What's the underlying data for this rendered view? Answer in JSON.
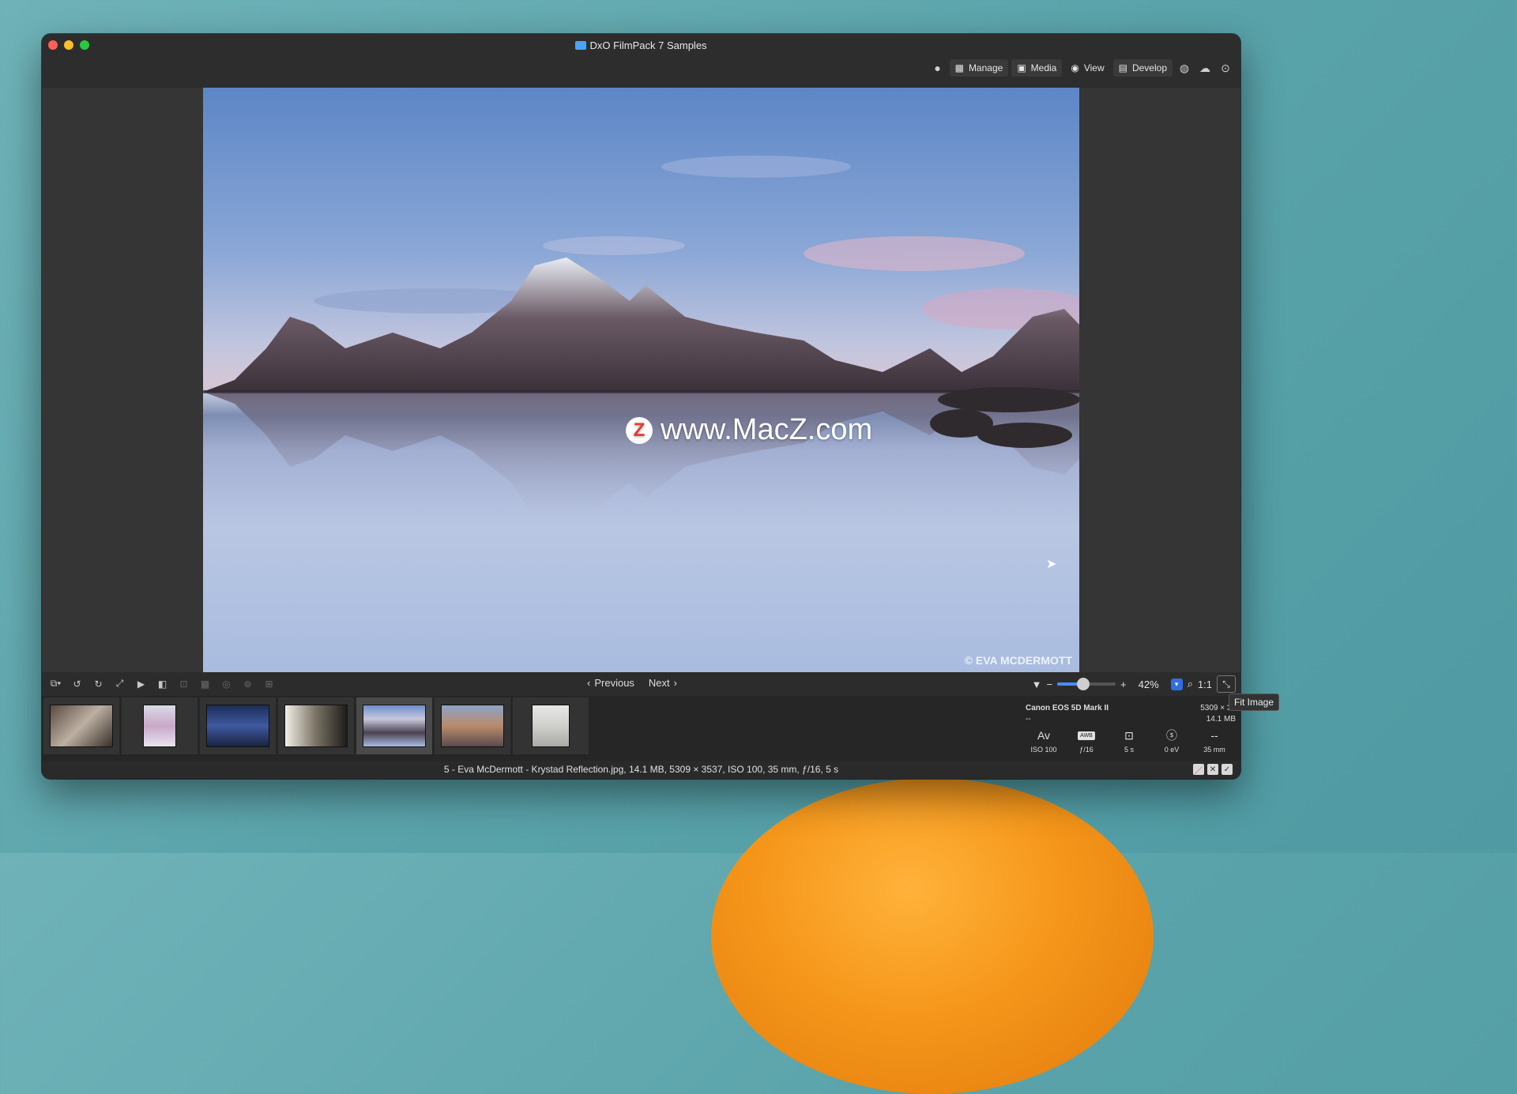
{
  "window": {
    "title": "DxO FilmPack 7 Samples"
  },
  "toolbar": {
    "manage_label": "Manage",
    "media_label": "Media",
    "view_label": "View",
    "develop_label": "Develop"
  },
  "photo": {
    "watermark": "www.MacZ.com",
    "watermark_badge": "Z",
    "copyright": "© EVA MCDERMOTT"
  },
  "navigation": {
    "previous_label": "Previous",
    "next_label": "Next"
  },
  "zoom": {
    "minus": "−",
    "plus": "+",
    "value": "42%",
    "one_to_one": "1:1",
    "slider_level": 0.44
  },
  "tooltip": {
    "fit_image": "Fit Image"
  },
  "filmstrip": {
    "selected_index": 4,
    "count": 7
  },
  "info": {
    "camera": "Canon EOS 5D Mark II",
    "lens": "--",
    "dimensions": "5309 × 35",
    "file_size": "14.1 MB",
    "iso": "ISO 100",
    "aperture": "ƒ/16",
    "shutter": "5 s",
    "exposure": "0 eV",
    "focal": "35 mm",
    "extra_dash": "--",
    "av_label": "Av",
    "awb_label": "AWB"
  },
  "status": {
    "text": "5 - Eva McDermott - Krystad Reflection.jpg, 14.1 MB, 5309 × 3537, ISO 100, 35 mm, ƒ/16, 5 s"
  },
  "colors": {
    "accent": "#2f6fe0",
    "window_bg": "#2a2a2a",
    "desktop": "#5aa3aa"
  }
}
